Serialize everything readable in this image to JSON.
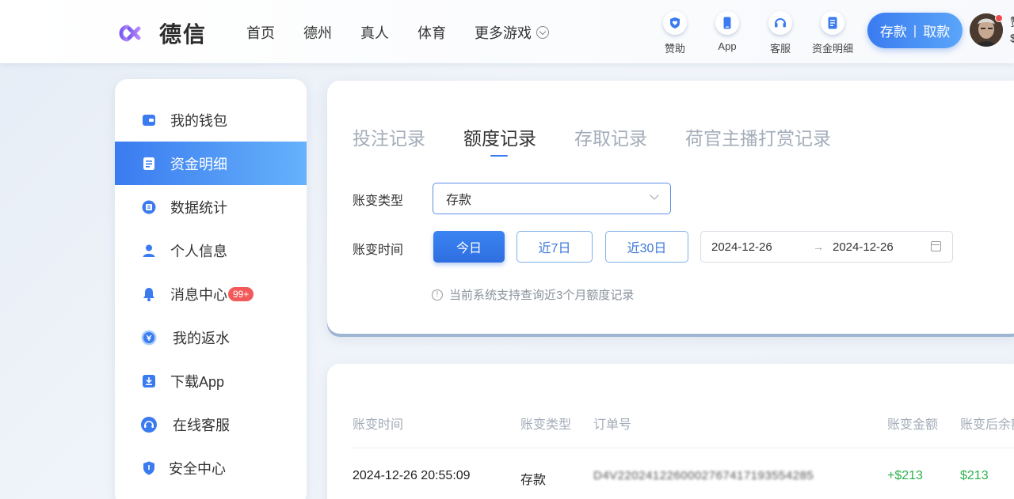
{
  "header": {
    "logo_text": "德信",
    "nav": [
      {
        "label": "首页"
      },
      {
        "label": "德州"
      },
      {
        "label": "真人"
      },
      {
        "label": "体育"
      },
      {
        "label": "更多游戏",
        "icon": "chevron-down-circle-icon"
      }
    ],
    "quick_links": [
      {
        "label": "赞助",
        "icon": "heart-shield-icon"
      },
      {
        "label": "App",
        "icon": "phone-icon"
      },
      {
        "label": "客服",
        "icon": "headset-icon"
      },
      {
        "label": "资金明细",
        "icon": "document-icon"
      }
    ],
    "deposit_label": "存款",
    "separator": "|",
    "withdraw_label": "取款",
    "edge_chars": [
      "赞",
      "$"
    ]
  },
  "sidebar": {
    "items": [
      {
        "label": "我的钱包",
        "icon": "wallet-icon"
      },
      {
        "label": "资金明细",
        "icon": "ledger-icon",
        "active": true
      },
      {
        "label": "数据统计",
        "icon": "stats-icon"
      },
      {
        "label": "个人信息",
        "icon": "user-icon"
      },
      {
        "label": "消息中心",
        "icon": "bell-icon",
        "badge": "99+"
      },
      {
        "label": "我的返水",
        "icon": "rebate-icon"
      },
      {
        "label": "下载App",
        "icon": "download-icon"
      },
      {
        "label": "在线客服",
        "icon": "headset-icon"
      },
      {
        "label": "安全中心",
        "icon": "shield-icon"
      }
    ]
  },
  "records": {
    "tabs": [
      {
        "label": "投注记录"
      },
      {
        "label": "额度记录",
        "active": true
      },
      {
        "label": "存取记录"
      },
      {
        "label": "荷官主播打赏记录"
      }
    ],
    "type_label": "账变类型",
    "type_value": "存款",
    "time_label": "账变时间",
    "quick_ranges": [
      "今日",
      "近7日",
      "近30日"
    ],
    "date_start": "2024-12-26",
    "date_arrow": "→",
    "date_end": "2024-12-26",
    "note": "当前系统支持查询近3个月额度记录",
    "info_glyph": "!"
  },
  "table": {
    "columns": [
      "账变时间",
      "账变类型",
      "订单号",
      "账变金额",
      "账变后余额"
    ],
    "rows": [
      {
        "time": "2024-12-26 20:55:09",
        "type": "存款",
        "order": "D4V2202412260002767417193554285",
        "amount": "+$213",
        "balance": "$213"
      }
    ]
  },
  "colors": {
    "accent": "#3a7bf0",
    "positive": "#2bb24c",
    "badge": "#f25a5a",
    "muted": "#a3acb9"
  }
}
